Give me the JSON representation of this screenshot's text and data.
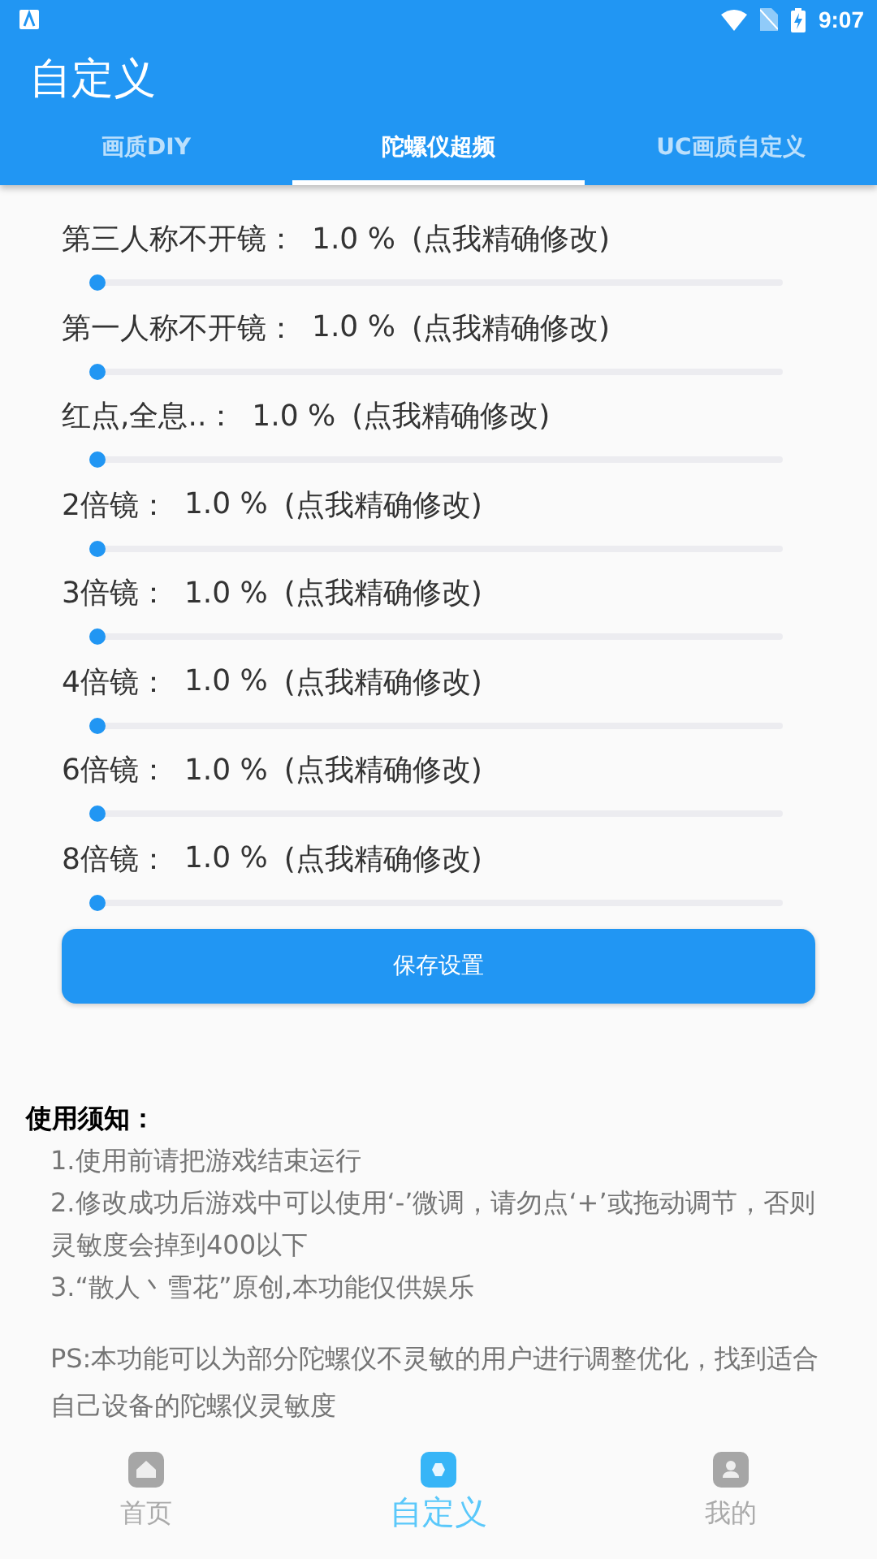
{
  "status_bar": {
    "time": "9:07"
  },
  "app_bar": {
    "title": "自定义"
  },
  "tabs": [
    {
      "label": "画质DIY",
      "selected": false
    },
    {
      "label": "陀螺仪超频",
      "selected": true
    },
    {
      "label": "UC画质自定义",
      "selected": false
    }
  ],
  "settings": [
    {
      "label": "第三人称不开镜：",
      "value": "1.0 %",
      "hint": "(点我精确修改)",
      "level": 0
    },
    {
      "label": "第一人称不开镜：",
      "value": "1.0 %",
      "hint": "(点我精确修改)",
      "level": 0
    },
    {
      "label": "红点,全息..：",
      "value": "1.0 %",
      "hint": "(点我精确修改)",
      "level": 0
    },
    {
      "label": "2倍镜：",
      "value": "1.0 %",
      "hint": "(点我精确修改)",
      "level": 0
    },
    {
      "label": "3倍镜：",
      "value": "1.0 %",
      "hint": "(点我精确修改)",
      "level": 0
    },
    {
      "label": "4倍镜：",
      "value": "1.0 %",
      "hint": "(点我精确修改)",
      "level": 0
    },
    {
      "label": "6倍镜：",
      "value": "1.0 %",
      "hint": "(点我精确修改)",
      "level": 0
    },
    {
      "label": "8倍镜：",
      "value": "1.0 %",
      "hint": "(点我精确修改)",
      "level": 0
    }
  ],
  "save_button": "保存设置",
  "notes": {
    "heading": "使用须知：",
    "items": [
      "1.使用前请把游戏结束运行",
      "2.修改成功后游戏中可以使用‘-’微调，请勿点‘+’或拖动调节，否则灵敏度会掉到400以下",
      "3.“散人丶雪花”原创,本功能仅供娱乐"
    ],
    "ps": "PS:本功能可以为部分陀螺仪不灵敏的用户进行调整优化，找到适合自己设备的陀螺仪灵敏度"
  },
  "bottom_nav": [
    {
      "label": "首页",
      "kind": "home",
      "selected": false
    },
    {
      "label": "自定义",
      "kind": "custom",
      "selected": true
    },
    {
      "label": "我的",
      "kind": "profile",
      "selected": false
    }
  ]
}
